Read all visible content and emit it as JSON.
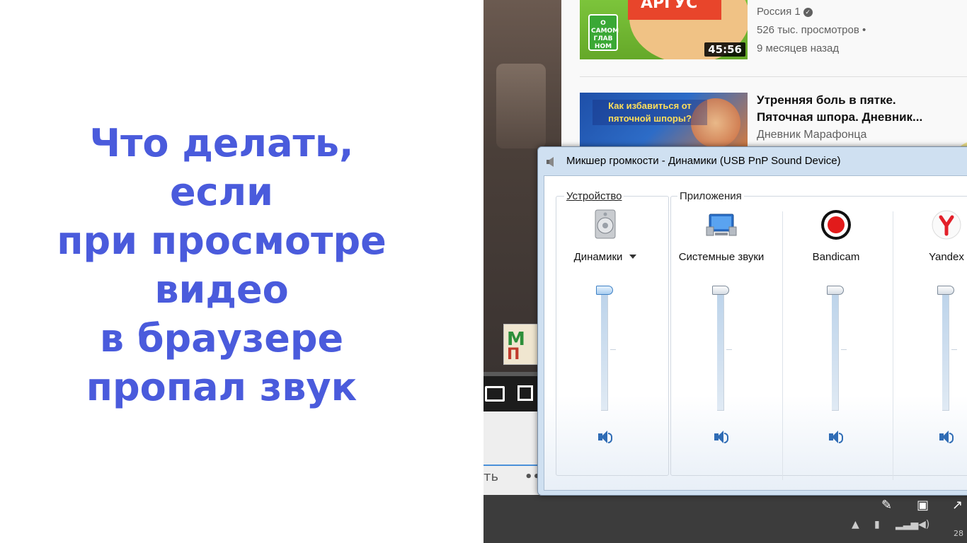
{
  "headline": {
    "lines": [
      "Что делать,",
      "если",
      "при просмотре",
      "видео",
      "в браузере",
      "пропал звук"
    ]
  },
  "recommendations": {
    "rec1": {
      "badge": "АРГУС",
      "logo": "О САМОМ ГЛАВ НОМ",
      "duration": "45:56",
      "channel": "Россия 1",
      "views": "526 тыс. просмотров •",
      "age": "9 месяцев назад"
    },
    "rec2": {
      "thumb_caption": "Как избавиться от пяточной шпоры?",
      "title_line1": "Утренняя боль в пятке.",
      "title_line2": "Пяточная шпора. Дневник...",
      "channel": "Дневник Марафонца"
    }
  },
  "video": {
    "below_text": "ть",
    "below_dots": "••"
  },
  "mixer": {
    "title": "Микшер громкости - Динамики (USB PnP Sound Device)",
    "device_group": "Устройство",
    "apps_group": "Приложения",
    "channels": [
      {
        "name": "Динамики",
        "icon": "speaker-device-icon",
        "level": 1.0
      },
      {
        "name": "Системные звуки",
        "icon": "system-sounds-icon",
        "level": 1.0
      },
      {
        "name": "Bandicam",
        "icon": "bandicam-icon",
        "level": 1.0
      },
      {
        "name": "Yandex",
        "icon": "yandex-browser-icon",
        "level": 1.0
      }
    ]
  },
  "colors": {
    "headline": "#4a5bdc",
    "mixer_frame": "#cfe0f1",
    "mute_icon": "#2f6cb5"
  },
  "tray": {
    "clock_fragment": "28"
  }
}
